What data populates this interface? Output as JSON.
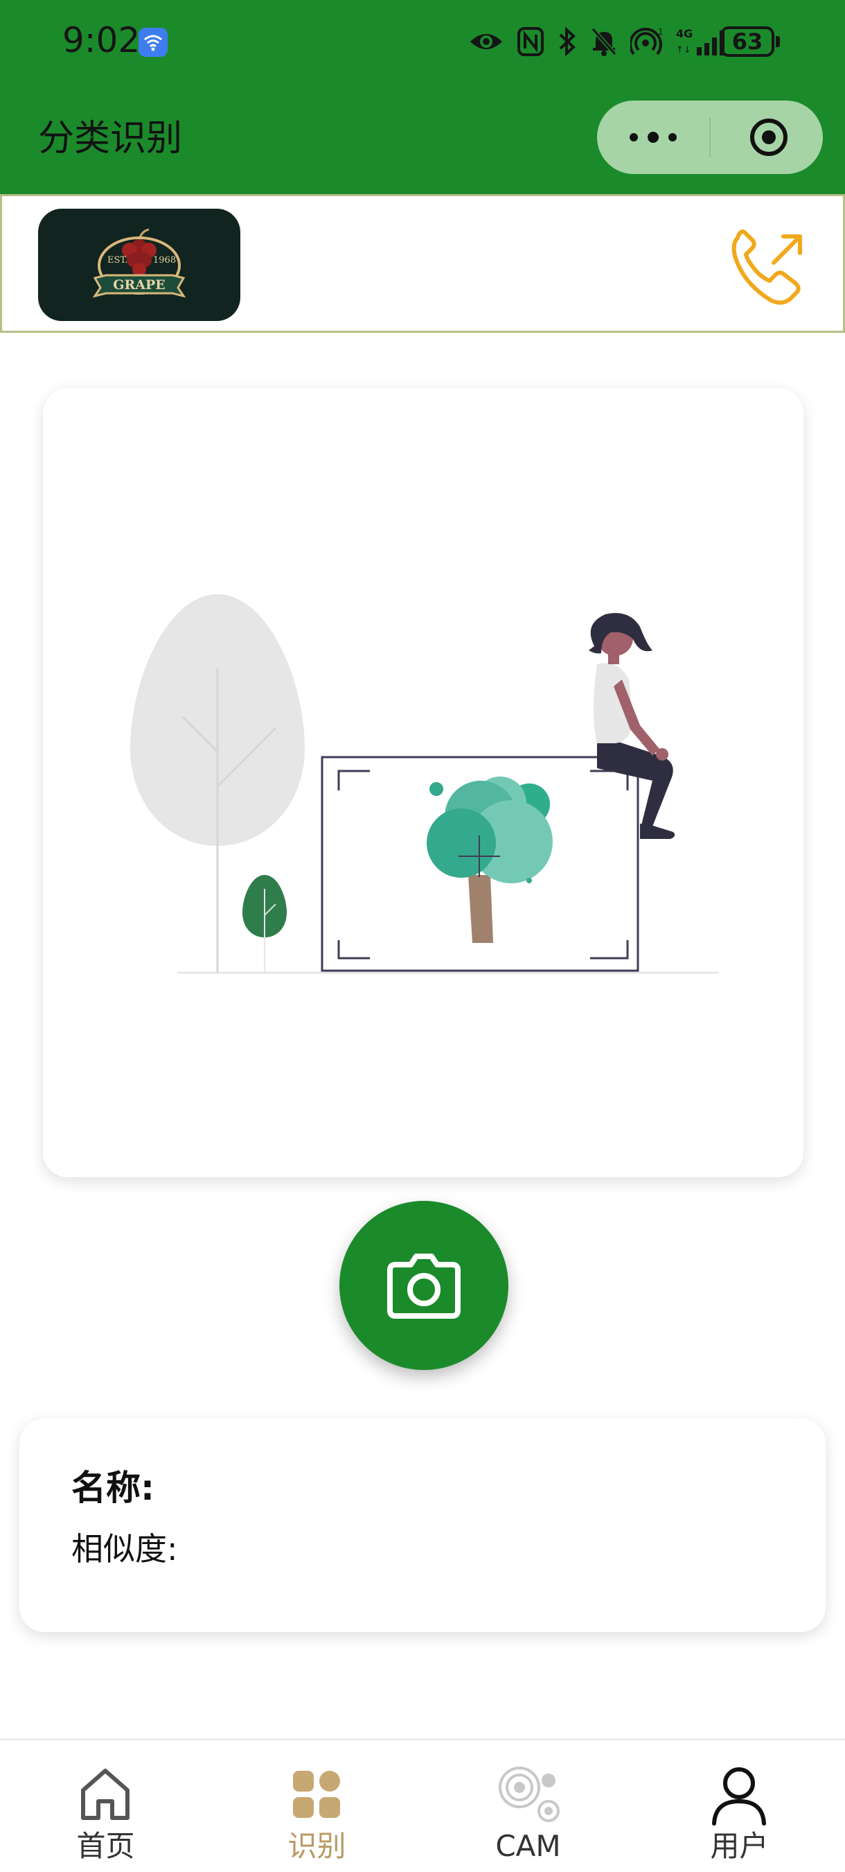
{
  "status_bar": {
    "time": "9:02",
    "battery": "63",
    "icons": [
      "wifi-badge-icon",
      "eye-icon",
      "nfc-icon",
      "bluetooth-icon",
      "mute-bell-icon",
      "hotspot-icon",
      "4g-signal-icon",
      "battery-icon"
    ]
  },
  "header": {
    "title": "分类识别",
    "capsule": {
      "more_icon": "more-dots-icon",
      "close_icon": "target-close-icon"
    }
  },
  "brand": {
    "logo_text": "GRAPE",
    "logo_est": "EST.",
    "logo_year": "1968",
    "phone_icon": "phone-outgoing-icon"
  },
  "main": {
    "illustration": "tree-scan-illustration",
    "camera_icon": "camera-icon"
  },
  "result": {
    "name_label": "名称:",
    "name_value": "",
    "similarity_label": "相似度:",
    "similarity_value": ""
  },
  "tabbar": {
    "items": [
      {
        "label": "首页",
        "icon": "home-icon",
        "active": false
      },
      {
        "label": "识别",
        "icon": "grid-icon",
        "active": true
      },
      {
        "label": "CAM",
        "icon": "cam-icon",
        "active": false
      },
      {
        "label": "用户",
        "icon": "user-icon",
        "active": false
      }
    ]
  },
  "colors": {
    "brand_green": "#1b8a2b",
    "capsule_bg": "#a6d4a6",
    "active_tab": "#b89a64",
    "phone_icon": "#f2a81d",
    "logo_bg": "#11241f"
  }
}
